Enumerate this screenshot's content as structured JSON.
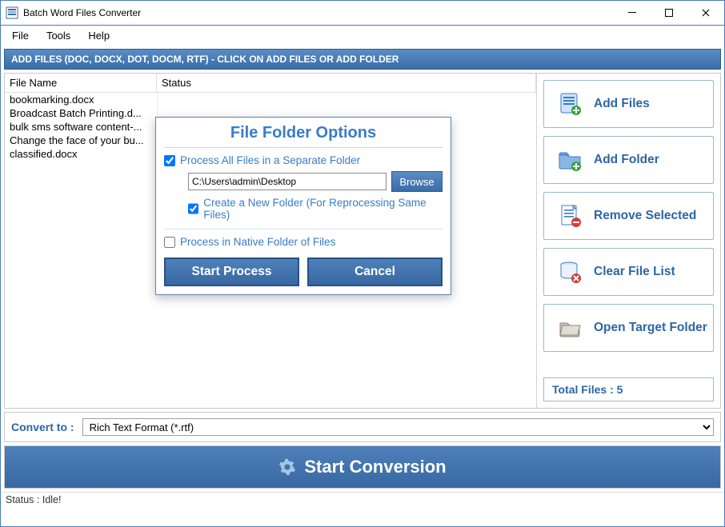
{
  "window": {
    "title": "Batch Word Files Converter"
  },
  "menu": {
    "file": "File",
    "tools": "Tools",
    "help": "Help"
  },
  "strip": {
    "text": "ADD FILES (DOC, DOCX, DOT, DOCM, RTF) - CLICK ON ADD FILES OR ADD FOLDER"
  },
  "grid": {
    "cols": {
      "file_name": "File Name",
      "status": "Status"
    },
    "rows": [
      {
        "file": "bookmarking.docx",
        "status": ""
      },
      {
        "file": "Broadcast Batch Printing.d...",
        "status": ""
      },
      {
        "file": "bulk sms software content-...",
        "status": ""
      },
      {
        "file": "Change the face of your bu...",
        "status": ""
      },
      {
        "file": "classified.docx",
        "status": ""
      }
    ]
  },
  "sidebar": {
    "add_files": "Add Files",
    "add_folder": "Add Folder",
    "remove_selected": "Remove Selected",
    "clear_list": "Clear File List",
    "open_target": "Open Target Folder",
    "total_files_label": "Total Files : 5"
  },
  "convert": {
    "label": "Convert to :",
    "value": "Rich Text Format (*.rtf)"
  },
  "start_conversion": "Start Conversion",
  "statusbar": "Status  :  Idle!",
  "modal": {
    "title": "File Folder Options",
    "process_separate": "Process All Files in a Separate Folder",
    "path": "C:\\Users\\admin\\Desktop",
    "browse": "Browse",
    "create_new": "Create a New Folder (For Reprocessing Same Files)",
    "process_native": "Process in Native Folder of Files",
    "start": "Start Process",
    "cancel": "Cancel"
  },
  "colors": {
    "accent": "#3a6da8",
    "link": "#3a7cc7"
  }
}
